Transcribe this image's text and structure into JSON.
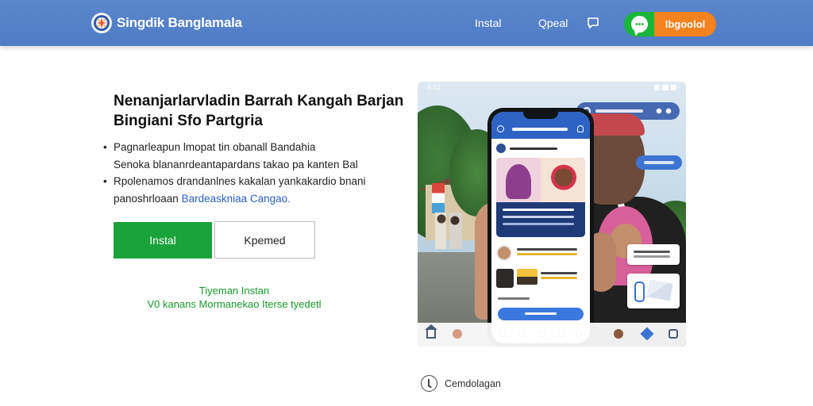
{
  "header": {
    "brand_name": "Singdik Banglamala",
    "nav": [
      {
        "label": "Instal"
      },
      {
        "label": "Qpeal"
      }
    ],
    "cta_label": "Ibgoolol",
    "colors": {
      "bar": "#5b86cc",
      "whatsapp": "#19b63a",
      "cta": "#f4821f"
    },
    "icons": [
      "logo-icon",
      "chat-bubble-icon",
      "whatsapp-icon"
    ]
  },
  "hero": {
    "title_lines": [
      "Nenanjarlarvladin Barrah Kangah Barjan",
      "Bingiani Sfo Partgria"
    ],
    "bullets": [
      {
        "lines": [
          "Pagnarleapun lmopat tin obanall Bandahia",
          "Senoka blananrdeantapardans takao pa kanten Bal"
        ]
      },
      {
        "lines": [
          "Rpolenamos drandanlnes kakalan yankakardio bnani"
        ],
        "last_line_prefix": "panoshrloaan",
        "last_line_link": "Bardeaskniaa Cangao."
      }
    ],
    "install_label": "Instal",
    "secondary_label": "Kpemed",
    "note_lines": [
      "Tiyeman Instan",
      "V0 kanans Mormanekao Iterse tyedetl"
    ],
    "colors": {
      "install": "#1aa33a",
      "note": "#169a2c",
      "link": "#2b5ec4"
    }
  },
  "preview": {
    "status_time": "9:41",
    "icons": [
      "search-icon",
      "home-icon",
      "heart-icon",
      "chat-icon"
    ]
  },
  "footer": {
    "label": "Cemdolagan",
    "icon": "clock-icon"
  }
}
